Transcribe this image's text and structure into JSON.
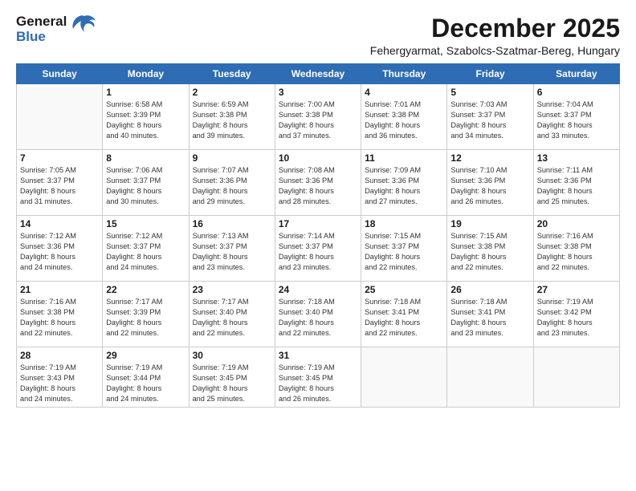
{
  "logo": {
    "line1": "General",
    "line2": "Blue"
  },
  "title": "December 2025",
  "subtitle": "Fehergyarmat, Szabolcs-Szatmar-Bereg, Hungary",
  "days_header": [
    "Sunday",
    "Monday",
    "Tuesday",
    "Wednesday",
    "Thursday",
    "Friday",
    "Saturday"
  ],
  "weeks": [
    [
      {
        "day": "",
        "info": ""
      },
      {
        "day": "1",
        "info": "Sunrise: 6:58 AM\nSunset: 3:39 PM\nDaylight: 8 hours\nand 40 minutes."
      },
      {
        "day": "2",
        "info": "Sunrise: 6:59 AM\nSunset: 3:38 PM\nDaylight: 8 hours\nand 39 minutes."
      },
      {
        "day": "3",
        "info": "Sunrise: 7:00 AM\nSunset: 3:38 PM\nDaylight: 8 hours\nand 37 minutes."
      },
      {
        "day": "4",
        "info": "Sunrise: 7:01 AM\nSunset: 3:38 PM\nDaylight: 8 hours\nand 36 minutes."
      },
      {
        "day": "5",
        "info": "Sunrise: 7:03 AM\nSunset: 3:37 PM\nDaylight: 8 hours\nand 34 minutes."
      },
      {
        "day": "6",
        "info": "Sunrise: 7:04 AM\nSunset: 3:37 PM\nDaylight: 8 hours\nand 33 minutes."
      }
    ],
    [
      {
        "day": "7",
        "info": "Sunrise: 7:05 AM\nSunset: 3:37 PM\nDaylight: 8 hours\nand 31 minutes."
      },
      {
        "day": "8",
        "info": "Sunrise: 7:06 AM\nSunset: 3:37 PM\nDaylight: 8 hours\nand 30 minutes."
      },
      {
        "day": "9",
        "info": "Sunrise: 7:07 AM\nSunset: 3:36 PM\nDaylight: 8 hours\nand 29 minutes."
      },
      {
        "day": "10",
        "info": "Sunrise: 7:08 AM\nSunset: 3:36 PM\nDaylight: 8 hours\nand 28 minutes."
      },
      {
        "day": "11",
        "info": "Sunrise: 7:09 AM\nSunset: 3:36 PM\nDaylight: 8 hours\nand 27 minutes."
      },
      {
        "day": "12",
        "info": "Sunrise: 7:10 AM\nSunset: 3:36 PM\nDaylight: 8 hours\nand 26 minutes."
      },
      {
        "day": "13",
        "info": "Sunrise: 7:11 AM\nSunset: 3:36 PM\nDaylight: 8 hours\nand 25 minutes."
      }
    ],
    [
      {
        "day": "14",
        "info": "Sunrise: 7:12 AM\nSunset: 3:36 PM\nDaylight: 8 hours\nand 24 minutes."
      },
      {
        "day": "15",
        "info": "Sunrise: 7:12 AM\nSunset: 3:37 PM\nDaylight: 8 hours\nand 24 minutes."
      },
      {
        "day": "16",
        "info": "Sunrise: 7:13 AM\nSunset: 3:37 PM\nDaylight: 8 hours\nand 23 minutes."
      },
      {
        "day": "17",
        "info": "Sunrise: 7:14 AM\nSunset: 3:37 PM\nDaylight: 8 hours\nand 23 minutes."
      },
      {
        "day": "18",
        "info": "Sunrise: 7:15 AM\nSunset: 3:37 PM\nDaylight: 8 hours\nand 22 minutes."
      },
      {
        "day": "19",
        "info": "Sunrise: 7:15 AM\nSunset: 3:38 PM\nDaylight: 8 hours\nand 22 minutes."
      },
      {
        "day": "20",
        "info": "Sunrise: 7:16 AM\nSunset: 3:38 PM\nDaylight: 8 hours\nand 22 minutes."
      }
    ],
    [
      {
        "day": "21",
        "info": "Sunrise: 7:16 AM\nSunset: 3:38 PM\nDaylight: 8 hours\nand 22 minutes."
      },
      {
        "day": "22",
        "info": "Sunrise: 7:17 AM\nSunset: 3:39 PM\nDaylight: 8 hours\nand 22 minutes."
      },
      {
        "day": "23",
        "info": "Sunrise: 7:17 AM\nSunset: 3:40 PM\nDaylight: 8 hours\nand 22 minutes."
      },
      {
        "day": "24",
        "info": "Sunrise: 7:18 AM\nSunset: 3:40 PM\nDaylight: 8 hours\nand 22 minutes."
      },
      {
        "day": "25",
        "info": "Sunrise: 7:18 AM\nSunset: 3:41 PM\nDaylight: 8 hours\nand 22 minutes."
      },
      {
        "day": "26",
        "info": "Sunrise: 7:18 AM\nSunset: 3:41 PM\nDaylight: 8 hours\nand 23 minutes."
      },
      {
        "day": "27",
        "info": "Sunrise: 7:19 AM\nSunset: 3:42 PM\nDaylight: 8 hours\nand 23 minutes."
      }
    ],
    [
      {
        "day": "28",
        "info": "Sunrise: 7:19 AM\nSunset: 3:43 PM\nDaylight: 8 hours\nand 24 minutes."
      },
      {
        "day": "29",
        "info": "Sunrise: 7:19 AM\nSunset: 3:44 PM\nDaylight: 8 hours\nand 24 minutes."
      },
      {
        "day": "30",
        "info": "Sunrise: 7:19 AM\nSunset: 3:45 PM\nDaylight: 8 hours\nand 25 minutes."
      },
      {
        "day": "31",
        "info": "Sunrise: 7:19 AM\nSunset: 3:45 PM\nDaylight: 8 hours\nand 26 minutes."
      },
      {
        "day": "",
        "info": ""
      },
      {
        "day": "",
        "info": ""
      },
      {
        "day": "",
        "info": ""
      }
    ]
  ]
}
